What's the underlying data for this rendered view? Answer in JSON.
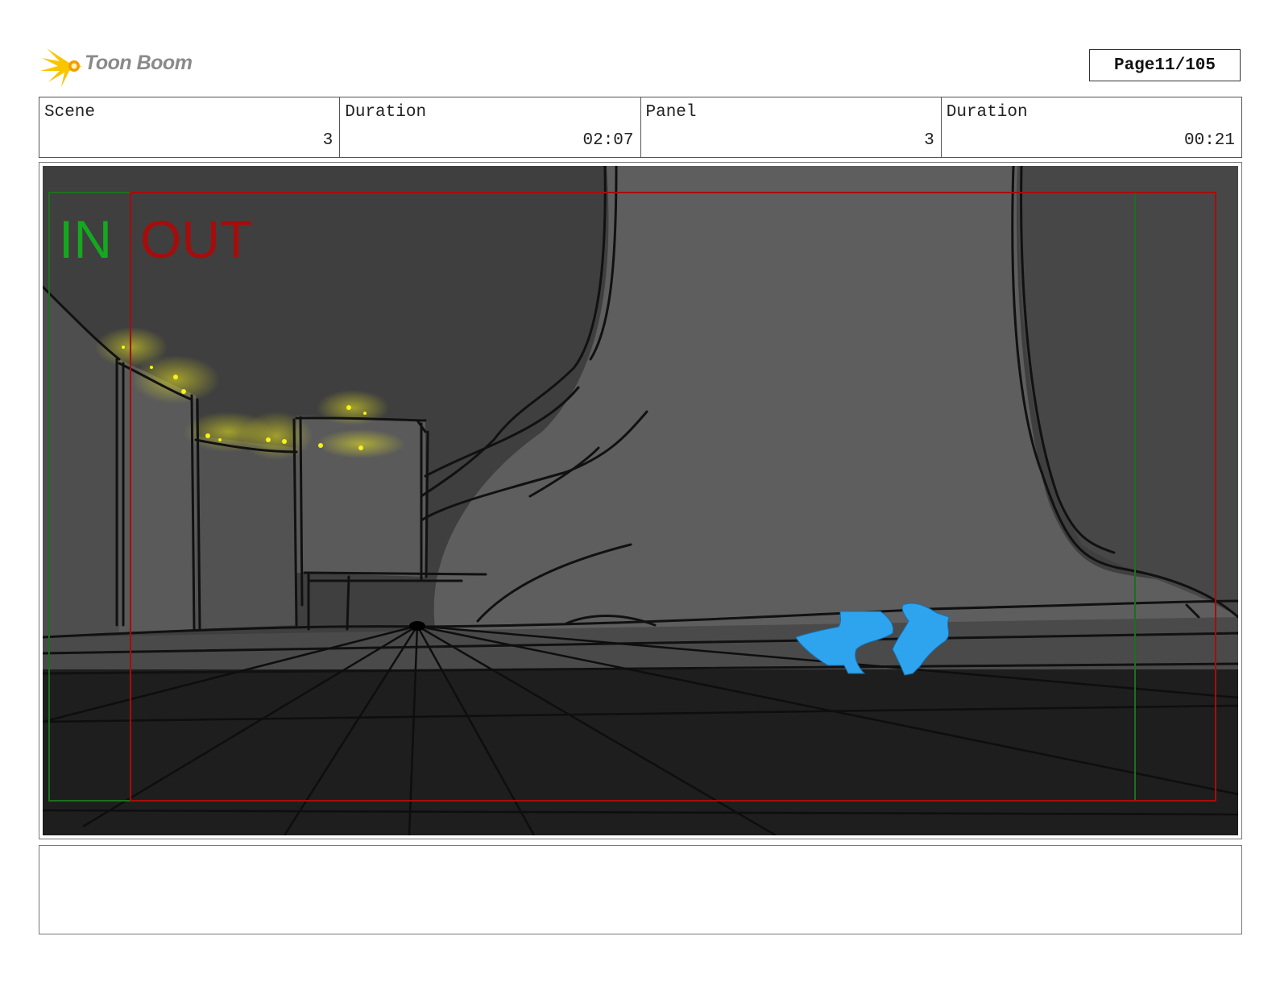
{
  "header": {
    "logo_text": "Toon Boom",
    "page_label": "Page",
    "page_number": "11/105"
  },
  "info": {
    "scene_label": "Scene",
    "scene_value": "3",
    "scene_duration_label": "Duration",
    "scene_duration_value": "02:07",
    "panel_label": "Panel",
    "panel_value": "3",
    "panel_duration_label": "Duration",
    "panel_duration_value": "00:21"
  },
  "panel": {
    "in_label": "IN",
    "out_label": "OUT",
    "in_color": "#14a81e",
    "out_color": "#a50d0d",
    "character_color": "#2ea4ee",
    "glow_color": "#f2ee1e"
  },
  "notes": {
    "text": ""
  }
}
